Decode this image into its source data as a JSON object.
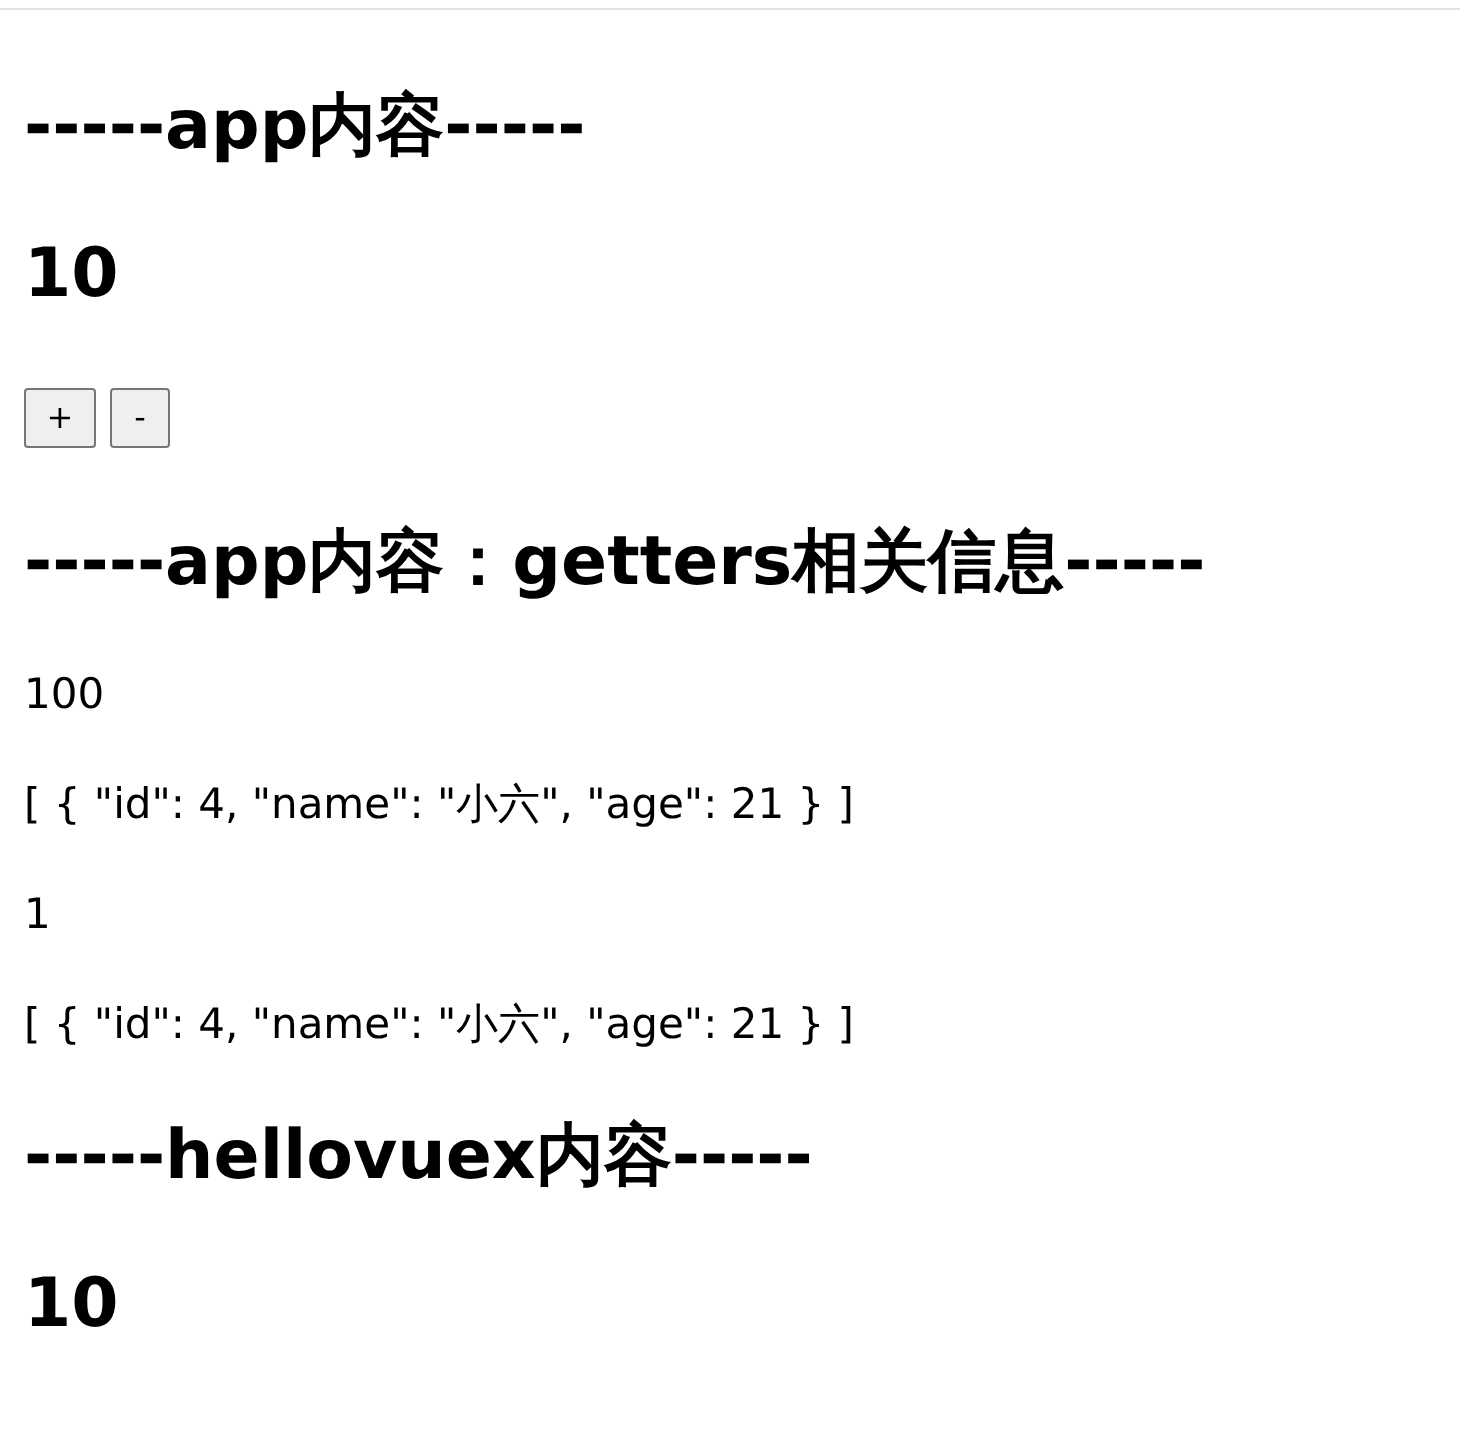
{
  "blocks": [
    {
      "kind": "heading",
      "text": "-----app内容-----"
    },
    {
      "kind": "value",
      "text": "10"
    },
    {
      "kind": "buttons",
      "buttons": [
        {
          "kind": "increment",
          "label": "+"
        },
        {
          "kind": "decrement",
          "label": "-"
        }
      ]
    },
    {
      "kind": "heading",
      "text": "-----app内容：getters相关信息-----"
    },
    {
      "kind": "line",
      "text": "100"
    },
    {
      "kind": "line",
      "text": "[ { \"id\": 4, \"name\": \"小六\", \"age\": 21 } ]"
    },
    {
      "kind": "line",
      "text": "1"
    },
    {
      "kind": "line",
      "text": "[ { \"id\": 4, \"name\": \"小六\", \"age\": 21 } ]"
    },
    {
      "kind": "heading",
      "text": "-----hellovuex内容-----"
    },
    {
      "kind": "value",
      "text": "10"
    }
  ]
}
